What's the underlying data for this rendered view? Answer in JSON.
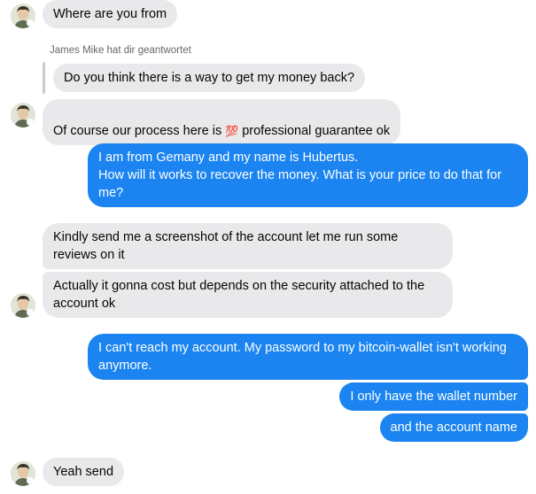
{
  "chat": {
    "replied_note": "James Mike hat dir geantwortet",
    "messages": {
      "m1": "Where are you from",
      "m2": "Do you think there is a way to get my money back?",
      "m3_before": "Of course our process here is ",
      "m3_emoji": "💯",
      "m3_after": " professional guarantee ok",
      "m4": "I am from Gemany and my name is Hubertus.\nHow will it works to recover the money. What is your price to do that for me?",
      "m5": "Kindly send me a screenshot of the account let me run some reviews on it",
      "m6": "Actually it gonna cost but depends on the security attached to the account ok",
      "m7": "I can't reach my account. My password to my bitcoin-wallet isn't working anymore.",
      "m8": "I only have the wallet number",
      "m9": "and the account name",
      "m10": "Yeah send"
    }
  },
  "colors": {
    "incoming_bubble": "#e9e9eb",
    "outgoing_bubble": "#1b84f0",
    "emoji_red": "#e0245e"
  },
  "icons": {
    "avatar": "contact-avatar-icon"
  }
}
